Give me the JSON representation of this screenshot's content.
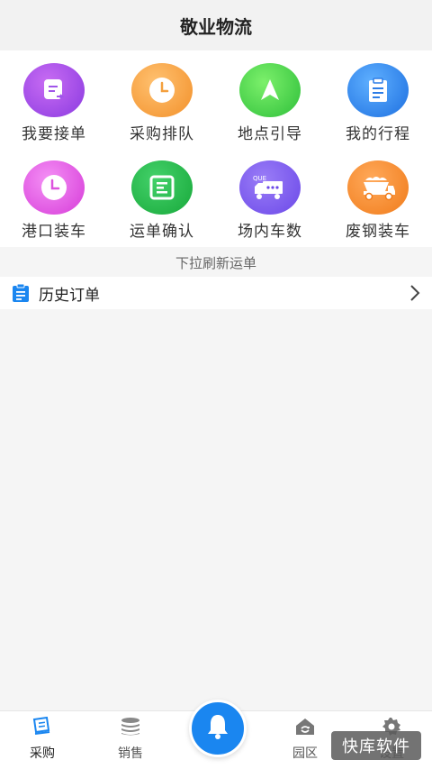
{
  "header": {
    "title": "敬业物流"
  },
  "grid": {
    "items": [
      {
        "label": "我要接单",
        "icon": "order-accept-icon"
      },
      {
        "label": "采购排队",
        "icon": "clock-icon"
      },
      {
        "label": "地点引导",
        "icon": "navigation-arrow-icon"
      },
      {
        "label": "我的行程",
        "icon": "clipboard-icon"
      },
      {
        "label": "港口装车",
        "icon": "clock-icon"
      },
      {
        "label": "运单确认",
        "icon": "document-list-icon"
      },
      {
        "label": "场内车数",
        "icon": "queue-truck-icon"
      },
      {
        "label": "废钢装车",
        "icon": "dump-truck-icon"
      }
    ],
    "queue_badge": "QUE"
  },
  "refresh_hint": "下拉刷新运单",
  "history": {
    "label": "历史订单"
  },
  "tabbar": {
    "items": [
      {
        "label": "采购",
        "icon": "book-icon"
      },
      {
        "label": "销售",
        "icon": "database-icon"
      },
      {
        "label": "园区",
        "icon": "home-icon"
      },
      {
        "label": "设置",
        "icon": "gear-icon"
      }
    ],
    "center_icon": "bell-icon"
  },
  "watermark": "快库软件",
  "colors": {
    "primary": "#1a86f0"
  }
}
